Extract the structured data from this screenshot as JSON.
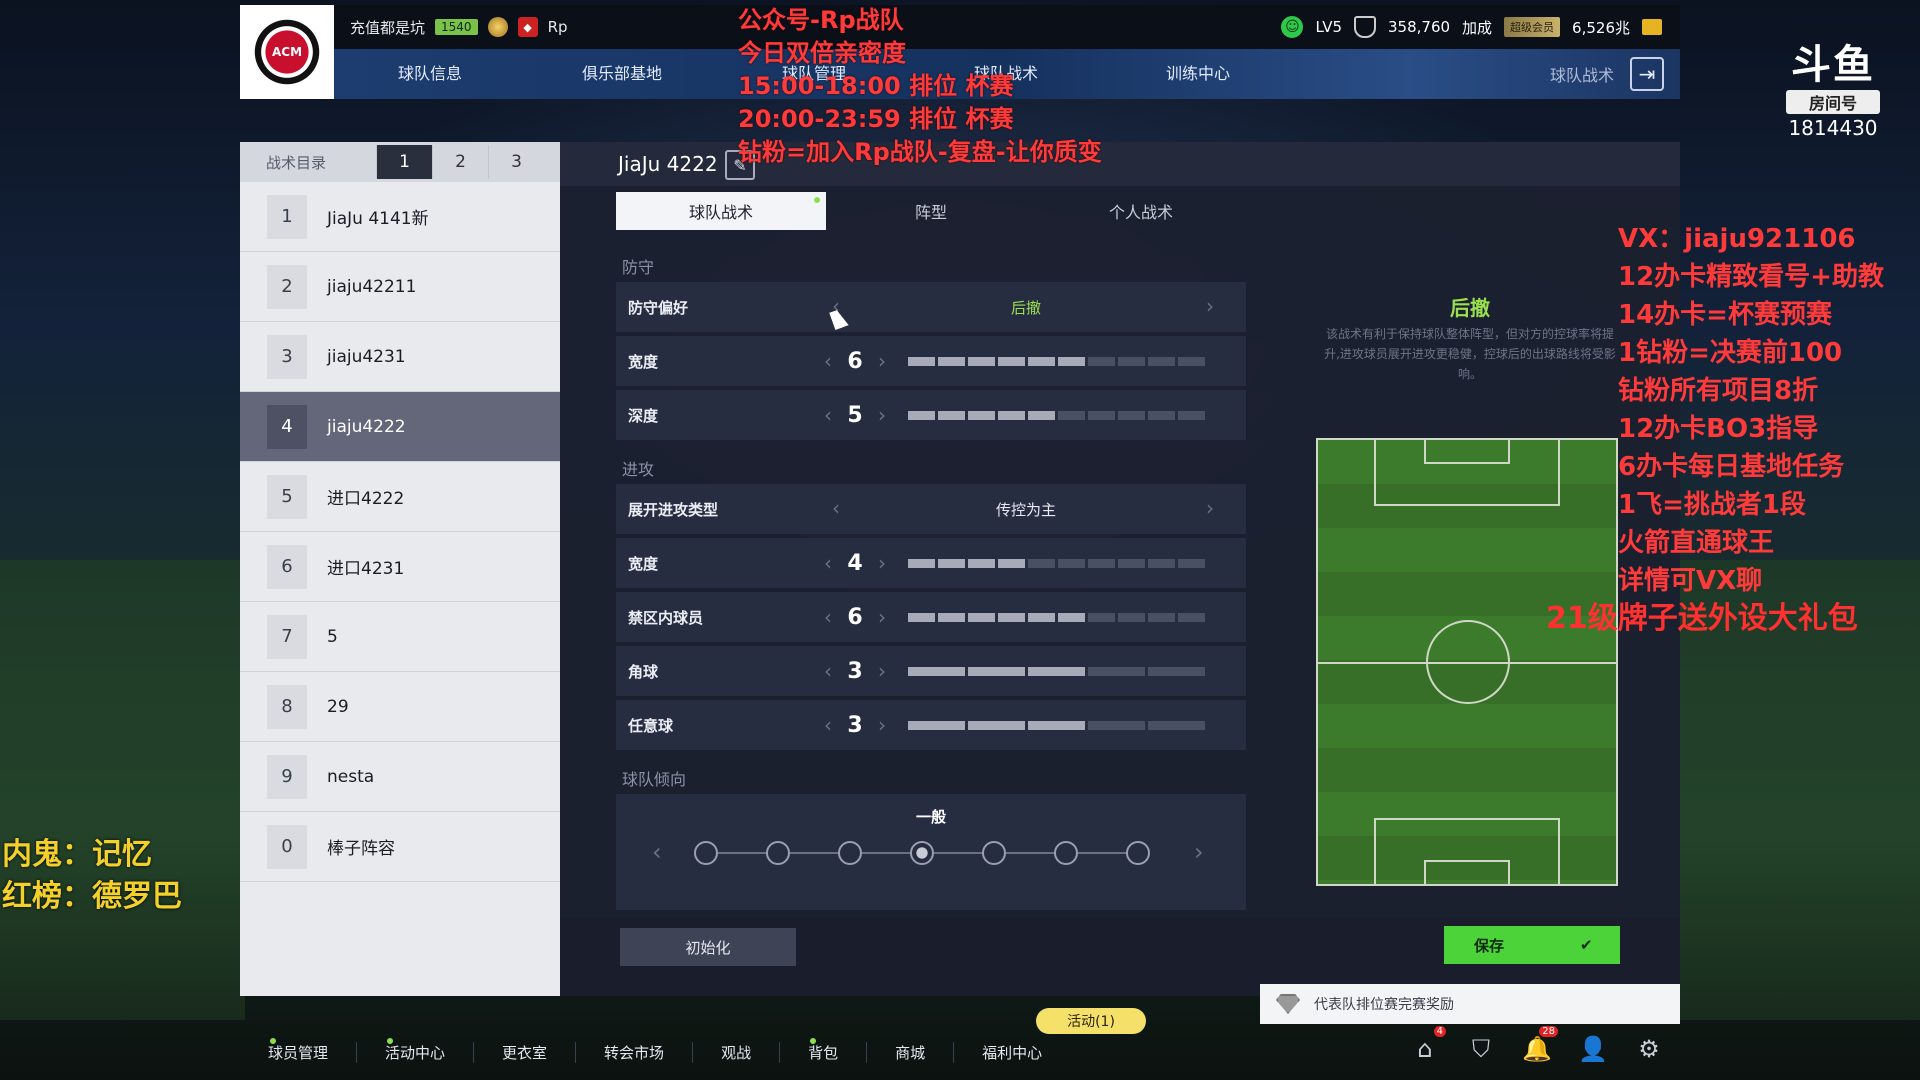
{
  "header": {
    "club_badge": "AC Milan crest",
    "user_name": "充值都是坑",
    "level_badge": "1540",
    "rp_label": "Rp",
    "vip_level": "LV5",
    "points": "358,760",
    "bonus_label": "加成",
    "vip_tag": "超级会员",
    "coins": "6,526兆",
    "nav": [
      "球队信息",
      "俱乐部基地",
      "球队管理",
      "球队战术",
      "训练中心"
    ],
    "nav_right_label": "球队战术"
  },
  "left_panel": {
    "title": "战术目录",
    "pages": [
      "1",
      "2",
      "3"
    ],
    "active_page": "1",
    "items": [
      {
        "index": "1",
        "name": "JiaJu 4141新"
      },
      {
        "index": "2",
        "name": "jiaju42211"
      },
      {
        "index": "3",
        "name": "jiaju4231"
      },
      {
        "index": "4",
        "name": "jiaju4222"
      },
      {
        "index": "5",
        "name": "进口4222"
      },
      {
        "index": "6",
        "name": "进口4231"
      },
      {
        "index": "7",
        "name": "5"
      },
      {
        "index": "8",
        "name": "29"
      },
      {
        "index": "9",
        "name": "nesta"
      },
      {
        "index": "0",
        "name": "棒子阵容"
      }
    ],
    "selected_index": "4"
  },
  "main": {
    "tactic_name": "JiaJu 4222",
    "tabs": [
      "球队战术",
      "阵型",
      "个人战术"
    ],
    "defense": {
      "section": "防守",
      "preference_label": "防守偏好",
      "preference_value": "后撤",
      "width_label": "宽度",
      "width_value": "6",
      "depth_label": "深度",
      "depth_value": "5"
    },
    "attack": {
      "section": "进攻",
      "type_label": "展开进攻类型",
      "type_value": "传控为主",
      "width_label": "宽度",
      "width_value": "4",
      "box_label": "禁区内球员",
      "box_value": "6",
      "corner_label": "角球",
      "corner_value": "3",
      "freekick_label": "任意球",
      "freekick_value": "3"
    },
    "tendency": {
      "section": "球队倾向",
      "value_label": "一般",
      "steps": 7,
      "active_step": 4
    },
    "detail": {
      "title": "后撤",
      "description": "该战术有利于保持球队整体阵型，但对方的控球率将提升,进攻球员展开进攻更稳健，控球后的出球路线将受影响。"
    },
    "reset_label": "初始化",
    "save_label": "保存",
    "reward_note": "代表队排位赛完赛奖励"
  },
  "bottom_nav": {
    "items": [
      "球员管理",
      "活动中心",
      "更衣室",
      "转会市场",
      "观战",
      "背包",
      "商城",
      "福利中心"
    ],
    "activity_pill": "活动(1)",
    "home_badge": "4",
    "bell_badge": "28"
  },
  "overlay": {
    "top_lines": [
      "公众号-Rp战队",
      "今日双倍亲密度",
      "15:00-18:00 排位  杯赛",
      "20:00-23:59  排位  杯赛",
      "钻粉=加入Rp战队-复盘-让你质变"
    ],
    "right_lines": [
      "VX：jiaju921106",
      "12办卡精致看号+助教",
      "14办卡=杯赛预赛",
      "1钻粉=决赛前100",
      "钻粉所有项目8折",
      "12办卡BO3指导",
      "6办卡每日基地任务",
      "1飞=挑战者1段",
      "火箭直通球王",
      "详情可VX聊"
    ],
    "right_last": "21级牌子送外设大礼包",
    "left_lines": [
      "内鬼：记忆",
      "红榜：德罗巴"
    ],
    "douyu_logo": "斗鱼",
    "room_label": "房间号",
    "room_number": "1814430"
  },
  "colors": {
    "accent_green": "#9be04f",
    "save_green": "#4cd33a",
    "overlay_red": "#ff3a3a",
    "overlay_yellow": "#f4d02a"
  }
}
